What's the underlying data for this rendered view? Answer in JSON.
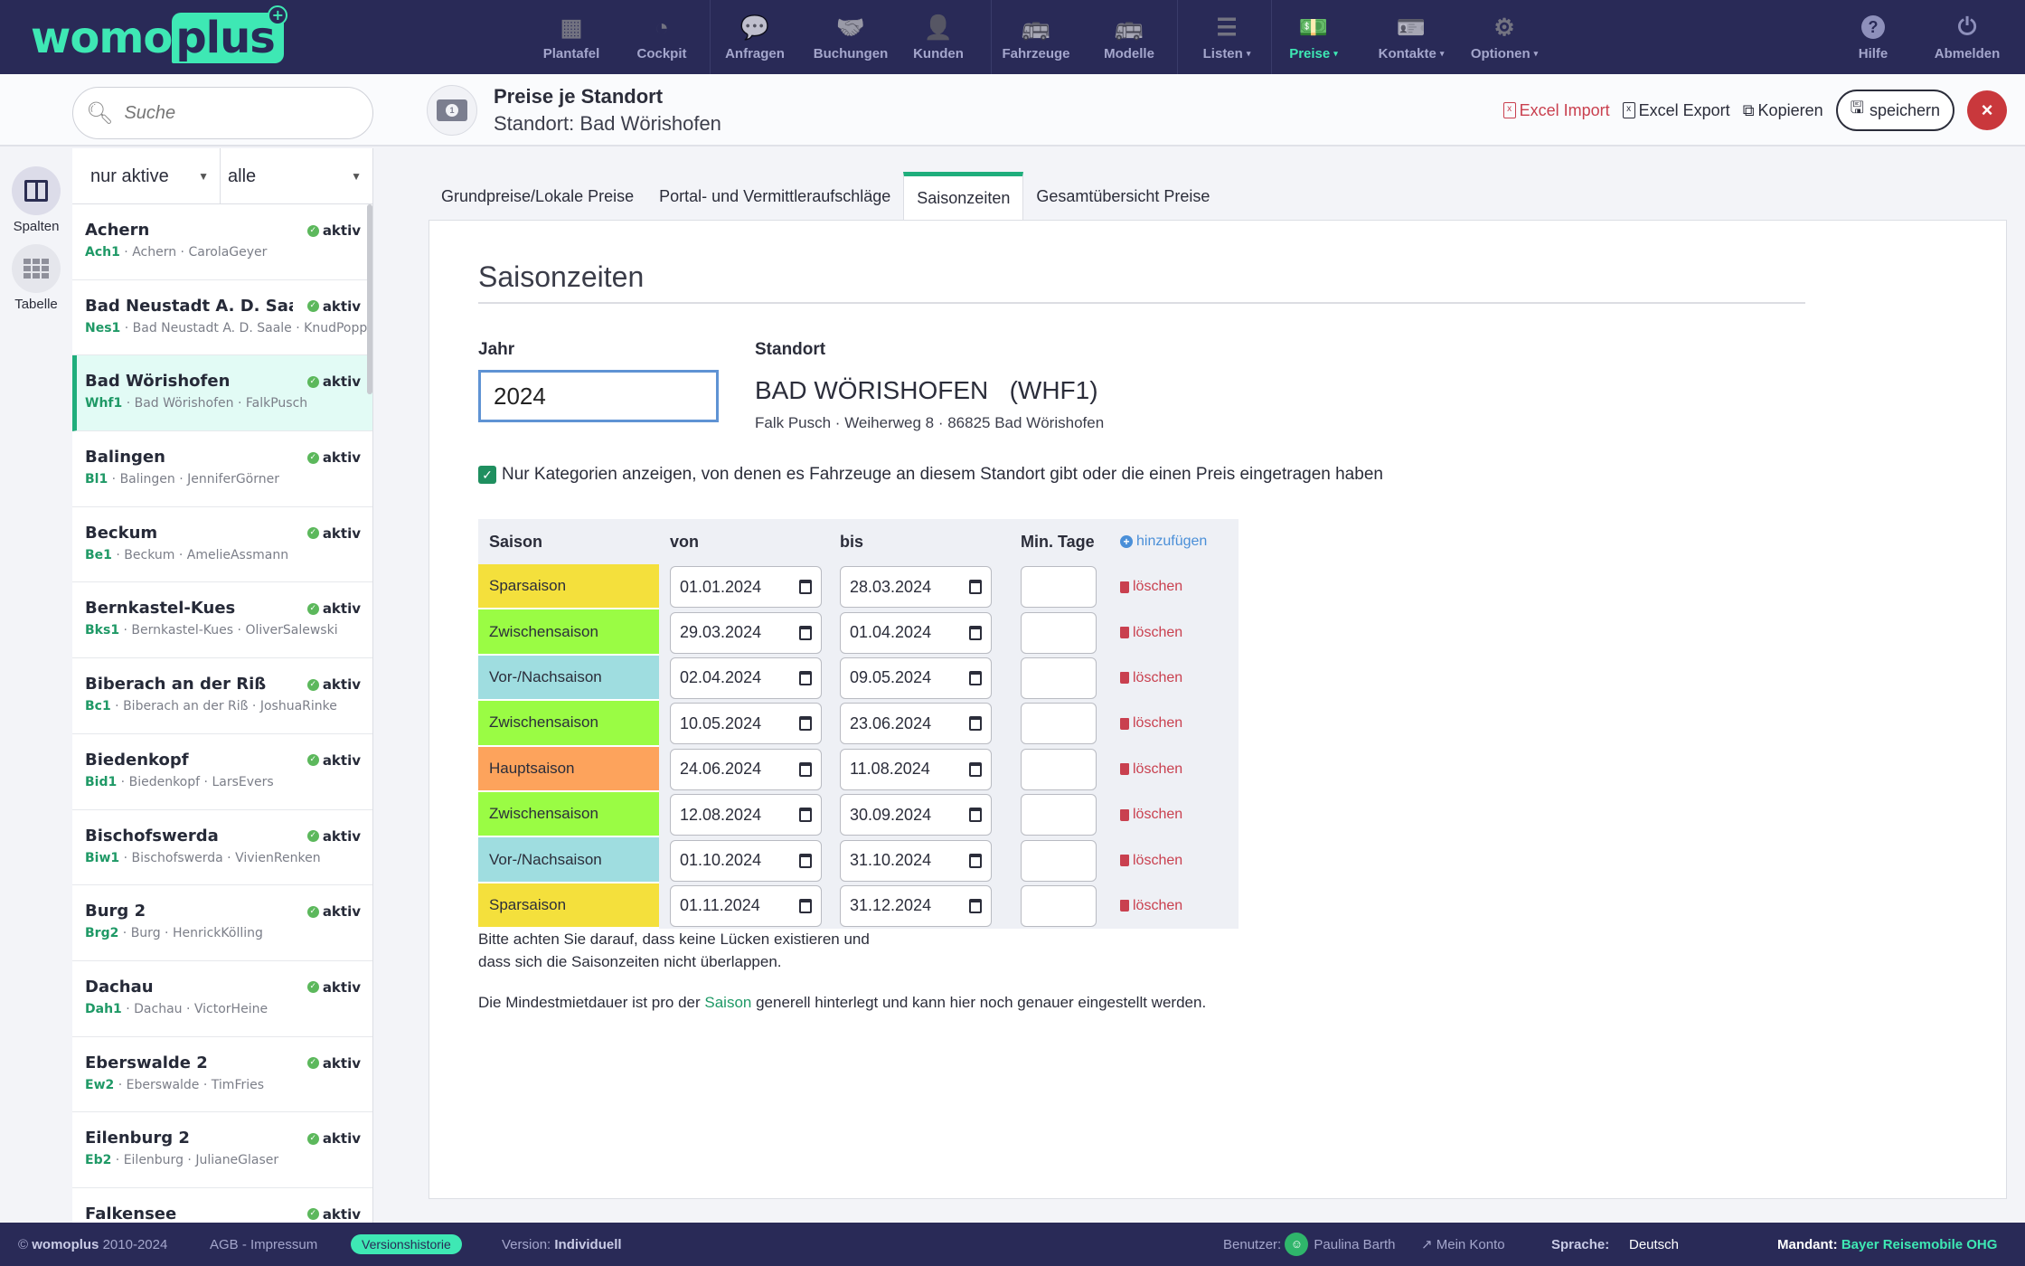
{
  "brand": {
    "part1": "womo",
    "part2": "plus"
  },
  "nav": {
    "items": [
      {
        "label": "Plantafel",
        "icon": "grid-icon"
      },
      {
        "label": "Cockpit",
        "icon": "gauge-icon"
      },
      {
        "label": "Anfragen",
        "icon": "question-bubble-icon"
      },
      {
        "label": "Buchungen",
        "icon": "handshake-icon"
      },
      {
        "label": "Kunden",
        "icon": "address-book-icon"
      },
      {
        "label": "Fahrzeuge",
        "icon": "bus-icon"
      },
      {
        "label": "Modelle",
        "icon": "bus-icon"
      },
      {
        "label": "Listen",
        "icon": "list-icon",
        "caret": "▾"
      },
      {
        "label": "Preise",
        "icon": "money-icon",
        "caret": "▾",
        "active": true
      },
      {
        "label": "Kontakte",
        "icon": "contact-card-icon",
        "caret": "▾"
      },
      {
        "label": "Optionen",
        "icon": "gears-icon",
        "caret": "▾"
      }
    ],
    "help": "Hilfe",
    "logout": "Abmelden"
  },
  "search": {
    "placeholder": "Suche"
  },
  "header": {
    "title": "Preise je Standort",
    "subtitle": "Standort: Bad Wörishofen",
    "excel_import": "Excel Import",
    "excel_export": "Excel Export",
    "copy": "Kopieren",
    "save": "speichern",
    "close": "×"
  },
  "rail": {
    "columns": "Spalten",
    "table": "Tabelle"
  },
  "filters": {
    "status": "nur aktive",
    "type": "alle"
  },
  "locations": [
    {
      "name": "Achern",
      "code": "Ach1",
      "city": "Achern",
      "contact": "CarolaGeyer",
      "status": "aktiv"
    },
    {
      "name": "Bad Neustadt A. D. Saale",
      "code": "Nes1",
      "city": "Bad Neustadt A. D. Saale",
      "contact": "KnudPoppe",
      "status": "aktiv"
    },
    {
      "name": "Bad Wörishofen",
      "code": "Whf1",
      "city": "Bad Wörishofen",
      "contact": "FalkPusch",
      "status": "aktiv",
      "selected": true
    },
    {
      "name": "Balingen",
      "code": "Bl1",
      "city": "Balingen",
      "contact": "JenniferGörner",
      "status": "aktiv"
    },
    {
      "name": "Beckum",
      "code": "Be1",
      "city": "Beckum",
      "contact": "AmelieAssmann",
      "status": "aktiv"
    },
    {
      "name": "Bernkastel-Kues",
      "code": "Bks1",
      "city": "Bernkastel-Kues",
      "contact": "OliverSalewski",
      "status": "aktiv"
    },
    {
      "name": "Biberach an der Riß",
      "code": "Bc1",
      "city": "Biberach an der Riß",
      "contact": "JoshuaRinke",
      "status": "aktiv"
    },
    {
      "name": "Biedenkopf",
      "code": "Bid1",
      "city": "Biedenkopf",
      "contact": "LarsEvers",
      "status": "aktiv"
    },
    {
      "name": "Bischofswerda",
      "code": "Biw1",
      "city": "Bischofswerda",
      "contact": "VivienRenken",
      "status": "aktiv"
    },
    {
      "name": "Burg 2",
      "code": "Brg2",
      "city": "Burg",
      "contact": "HenrickKölling",
      "status": "aktiv"
    },
    {
      "name": "Dachau",
      "code": "Dah1",
      "city": "Dachau",
      "contact": "VictorHeine",
      "status": "aktiv"
    },
    {
      "name": "Eberswalde 2",
      "code": "Ew2",
      "city": "Eberswalde",
      "contact": "TimFries",
      "status": "aktiv"
    },
    {
      "name": "Eilenburg 2",
      "code": "Eb2",
      "city": "Eilenburg",
      "contact": "JulianeGlaser",
      "status": "aktiv"
    },
    {
      "name": "Falkensee",
      "code": "",
      "city": "",
      "contact": "",
      "status": "aktiv"
    }
  ],
  "tabs": [
    {
      "label": "Grundpreise/Lokale Preise"
    },
    {
      "label": "Portal- und Vermittleraufschläge"
    },
    {
      "label": "Saisonzeiten",
      "active": true
    },
    {
      "label": "Gesamtübersicht Preise"
    }
  ],
  "main": {
    "section_title": "Saisonzeiten",
    "year_label": "Jahr",
    "year_value": "2024",
    "location_label": "Standort",
    "location_name": "BAD WÖRISHOFEN   (WHF1)",
    "location_address": "Falk Pusch · Weiherweg 8 · 86825 Bad Wörishofen",
    "checkbox_label": "Nur Kategorien anzeigen, von denen es Fahrzeuge an diesem Standort gibt oder die einen Preis eingetragen haben",
    "checkbox_checked": true,
    "table": {
      "headers": {
        "saison": "Saison",
        "von": "von",
        "bis": "bis",
        "min": "Min. Tage",
        "add": "hinzufügen"
      },
      "delete_label": "löschen",
      "rows": [
        {
          "saison": "Sparsaison",
          "color": "#f4e03c",
          "von": "01.01.2024",
          "bis": "28.03.2024",
          "min": ""
        },
        {
          "saison": "Zwischensaison",
          "color": "#9afc44",
          "von": "29.03.2024",
          "bis": "01.04.2024",
          "min": ""
        },
        {
          "saison": "Vor-/Nachsaison",
          "color": "#9fdde0",
          "von": "02.04.2024",
          "bis": "09.05.2024",
          "min": ""
        },
        {
          "saison": "Zwischensaison",
          "color": "#9afc44",
          "von": "10.05.2024",
          "bis": "23.06.2024",
          "min": ""
        },
        {
          "saison": "Hauptsaison",
          "color": "#fda35c",
          "von": "24.06.2024",
          "bis": "11.08.2024",
          "min": ""
        },
        {
          "saison": "Zwischensaison",
          "color": "#9afc44",
          "von": "12.08.2024",
          "bis": "30.09.2024",
          "min": ""
        },
        {
          "saison": "Vor-/Nachsaison",
          "color": "#9fdde0",
          "von": "01.10.2024",
          "bis": "31.10.2024",
          "min": ""
        },
        {
          "saison": "Sparsaison",
          "color": "#f4e03c",
          "von": "01.11.2024",
          "bis": "31.12.2024",
          "min": ""
        }
      ]
    },
    "note1_line1": "Bitte achten Sie darauf, dass keine Lücken existieren und",
    "note1_line2": "dass sich die Saisonzeiten nicht überlappen.",
    "note2_before": "Die Mindestmietdauer ist pro der ",
    "note2_link": "Saison",
    "note2_after": " generell hinterlegt und kann hier noch genauer eingestellt werden."
  },
  "footer": {
    "copyright_prefix": "©",
    "copyright_brand": "womoplus",
    "copyright_years": "2010-2024",
    "legal": "AGB - Impressum",
    "version_history": "Versionshistorie",
    "version_label": "Version:",
    "version_value": "Individuell",
    "user_label": "Benutzer:",
    "user_name": "Paulina Barth",
    "account": "Mein Konto",
    "language_label": "Sprache:",
    "language_value": "Deutsch",
    "tenant_label": "Mandant:",
    "tenant_value": "Bayer Reisemobile OHG"
  }
}
